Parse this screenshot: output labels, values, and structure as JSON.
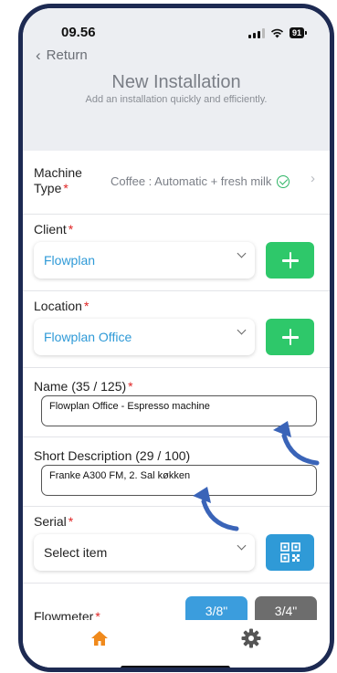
{
  "status_bar": {
    "time": "09.56",
    "battery": "91"
  },
  "nav": {
    "back_label": "Return"
  },
  "header": {
    "title": "New Installation",
    "subtitle": "Add an installation quickly and efficiently."
  },
  "form": {
    "machine_type": {
      "label_line1": "Machine",
      "label_line2": "Type",
      "required": "*",
      "value": "Coffee : Automatic + fresh milk"
    },
    "client": {
      "label": "Client",
      "required": "*",
      "value": "Flowplan"
    },
    "location": {
      "label": "Location",
      "required": "*",
      "value": "Flowplan Office"
    },
    "name": {
      "label": "Name (35 / 125)",
      "required": "*",
      "value": "Flowplan Office -  Espresso machine"
    },
    "short_description": {
      "label": "Short Description (29 / 100)",
      "value": "Franke A300 FM, 2. Sal køkken"
    },
    "serial": {
      "label": "Serial",
      "required": "*",
      "placeholder": "Select item"
    },
    "flowmeter": {
      "label": "Flowmeter",
      "required": "*",
      "options": [
        "3/8\"",
        "3/4\""
      ],
      "selected": "3/8\""
    }
  },
  "icons": {
    "home": "home-icon",
    "settings": "gear-icon",
    "qr": "qr-code-icon",
    "check": "check-circle-icon"
  },
  "colors": {
    "accent_blue": "#2f9ad7",
    "add_green": "#2ec86a",
    "home_active": "#f08a1c",
    "frame": "#1d2a52",
    "arrow": "#3a64b8"
  }
}
